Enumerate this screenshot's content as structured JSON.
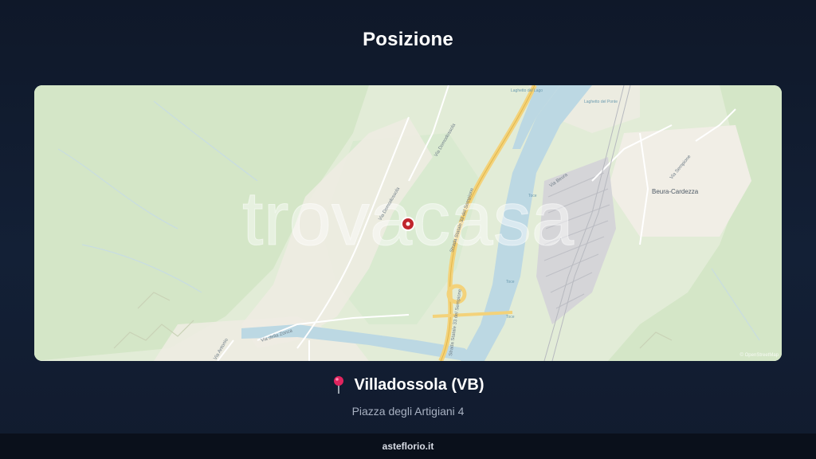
{
  "page": {
    "title": "Posizione"
  },
  "map": {
    "watermark": "trovacasa",
    "attribution": "© OpenStreetMap",
    "labels": {
      "village": "Beura-Cardezza",
      "road_domodossola_1": "Via Domodossola",
      "road_domodossola_2": "Via Domodossola",
      "road_state_1": "Strada Statale 33 del Sempione",
      "road_state_2": "Strada Statale 33 del Sempione",
      "road_beura": "Via Beura",
      "road_sempione": "Via Sempione",
      "road_zonca": "Via della Zonca",
      "road_antonio": "Via Antonio",
      "lake_1": "Laghetto del Lago",
      "lake_2": "Laghetto del Ponte",
      "river_1": "Toce",
      "river_2": "Toce",
      "river_3": "Toce"
    },
    "colors": {
      "land": "#e6efdc",
      "forest": "#d3e6c6",
      "urban": "#f3f0e9",
      "water": "#bcd8e3",
      "highway": "#f3d27a",
      "marker": "#c0262d"
    }
  },
  "location": {
    "pin_icon": "round-pushpin-icon",
    "name": "Villadossola (VB)",
    "address": "Piazza degli Artigiani 4"
  },
  "footer": {
    "brand": "asteflorio.it"
  }
}
